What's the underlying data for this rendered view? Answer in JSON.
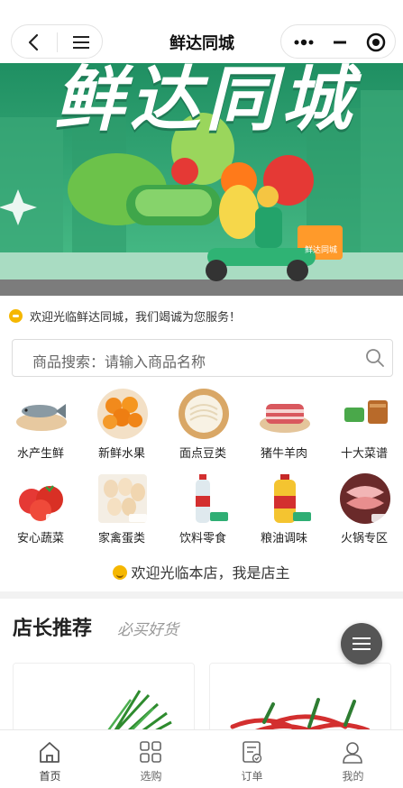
{
  "app": {
    "title": "鲜达同城"
  },
  "banner": {
    "title": "鲜达同城",
    "box_label": "鲜达同城"
  },
  "notice": {
    "text": "欢迎光临鲜达同城，我们竭诚为您服务！"
  },
  "search": {
    "placeholder": "商品搜索：请输入商品名称"
  },
  "categories": [
    {
      "label": "水产生鲜",
      "icon": "fish-icon"
    },
    {
      "label": "新鲜水果",
      "icon": "orange-icon"
    },
    {
      "label": "面点豆类",
      "icon": "noodle-icon"
    },
    {
      "label": "猪牛羊肉",
      "icon": "meat-icon"
    },
    {
      "label": "十大菜谱",
      "icon": "dish-icon"
    },
    {
      "label": "安心蔬菜",
      "icon": "tomato-icon"
    },
    {
      "label": "家禽蛋类",
      "icon": "egg-icon"
    },
    {
      "label": "饮料零食",
      "icon": "drink-icon"
    },
    {
      "label": "粮油调味",
      "icon": "oil-icon"
    },
    {
      "label": "火锅专区",
      "icon": "hotpot-icon"
    }
  ],
  "welcome": {
    "text": "欢迎光临本店，我是店主"
  },
  "recommend": {
    "title": "店长推荐",
    "subtitle": "必买好货"
  },
  "tabbar": {
    "items": [
      {
        "label": "首页",
        "icon": "home-icon",
        "active": true
      },
      {
        "label": "选购",
        "icon": "grid-icon",
        "active": false
      },
      {
        "label": "订单",
        "icon": "order-icon",
        "active": false
      },
      {
        "label": "我的",
        "icon": "user-icon",
        "active": false
      }
    ]
  },
  "colors": {
    "accent": "#2fae74",
    "tab_active": "#333333",
    "tab_inactive": "#666666"
  }
}
